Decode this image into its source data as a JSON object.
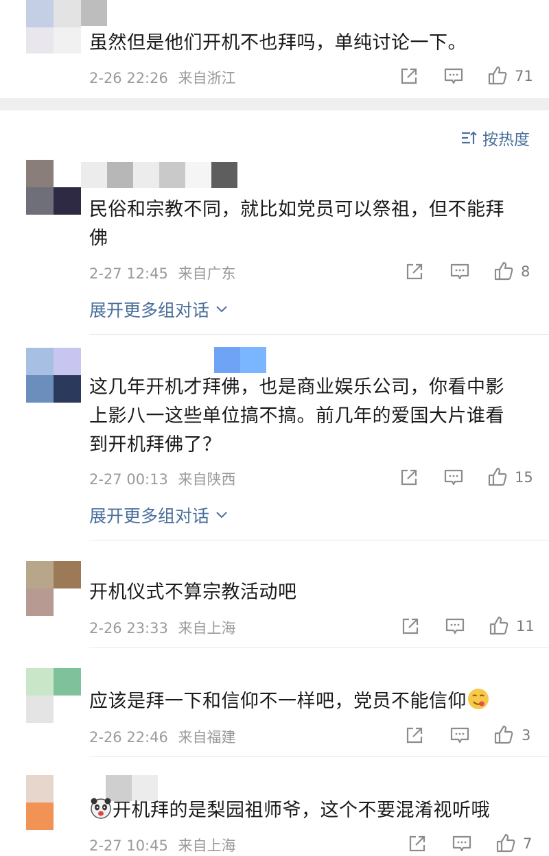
{
  "top_comment": {
    "text": "虽然但是他们开机不也拜吗，单纯讨论一下。",
    "time": "2-26 22:26",
    "location": "来自浙江",
    "likes": "71"
  },
  "sort": {
    "label": "按热度"
  },
  "comments": [
    {
      "text": "民俗和宗教不同，就比如党员可以祭祖，但不能拜佛",
      "time": "2-27 12:45",
      "location": "来自广东",
      "likes": "8",
      "expand": "展开更多组对话"
    },
    {
      "text": "这几年开机才拜佛，也是商业娱乐公司，你看中影上影八一这些单位搞不搞。前几年的爱国大片谁看到开机拜佛了？",
      "time": "2-27 00:13",
      "location": "来自陕西",
      "likes": "15",
      "expand": "展开更多组对话"
    },
    {
      "text": "开机仪式不算宗教活动吧",
      "time": "2-26 23:33",
      "location": "来自上海",
      "likes": "11"
    },
    {
      "text": "应该是拜一下和信仰不一样吧，党员不能信仰",
      "time": "2-26 22:46",
      "location": "来自福建",
      "likes": "3",
      "emoji": "yum-face-emoji"
    },
    {
      "text": "开机拜的是梨园祖师爷，这个不要混淆视听哦",
      "time": "2-27 10:45",
      "location": "来自上海",
      "likes": "7",
      "emoji": "panda-face-emoji"
    }
  ],
  "colors": {
    "link": "#4a6f9c",
    "meta": "#9a9a9a",
    "separator": "#efefef"
  },
  "icons": [
    "share-icon",
    "comment-icon",
    "like-icon",
    "chevron-down-icon",
    "sort-icon"
  ]
}
